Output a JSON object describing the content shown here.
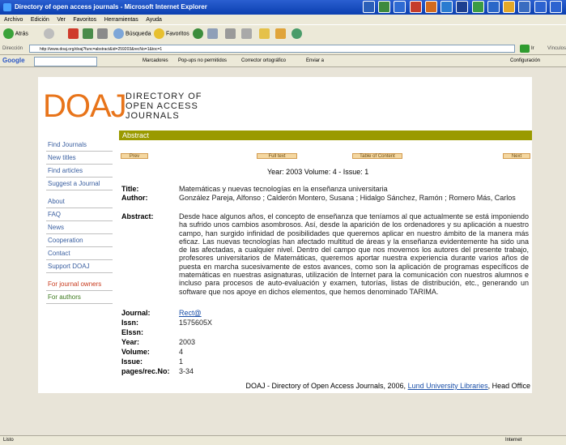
{
  "window": {
    "title": "Directory of open access journals - Microsoft Internet Explorer"
  },
  "menubar": [
    "Archivo",
    "Edición",
    "Ver",
    "Favoritos",
    "Herramientas",
    "Ayuda"
  ],
  "toolbar": {
    "back_label": "Atrás",
    "search_label": "Búsqueda",
    "favorites_label": "Favoritos"
  },
  "addressbar": {
    "label": "Dirección",
    "url": "http://www.doaj.org/doaj?func=abstract&id=259203&recNo=1&toc=1",
    "go_label": "Ir",
    "links_label": "Vínculos"
  },
  "googlebar": {
    "logo": "Google",
    "bookmarks_label": "Marcadores",
    "popups_label": "Pop-ups no permitidos",
    "spellcheck_label": "Corrector ortográfico",
    "send_label": "Enviar a",
    "settings_label": "Configuración"
  },
  "logo": {
    "acronym": "DOAJ",
    "line1": "DIRECTORY OF",
    "line2": "OPEN ACCESS",
    "line3": "JOURNALS"
  },
  "sidebar": {
    "items": [
      {
        "label": "Find Journals"
      },
      {
        "label": "New titles"
      },
      {
        "label": "Find articles"
      },
      {
        "label": "Suggest a Journal"
      },
      {
        "label": "About"
      },
      {
        "label": "FAQ"
      },
      {
        "label": "News"
      },
      {
        "label": "Cooperation"
      },
      {
        "label": "Contact"
      },
      {
        "label": "Support DOAJ"
      },
      {
        "label": "For journal owners"
      },
      {
        "label": "For authors"
      }
    ]
  },
  "abstract_header": "Abstract",
  "nav": {
    "prev": "Prev",
    "fulltext": "Full text",
    "toc": "Table of Content",
    "next": "Next"
  },
  "issue_line": "Year: 2003 Volume: 4 - Issue: 1",
  "fields": {
    "title_label": "Title:",
    "title_value": "Matemáticas y nuevas tecnologías en la enseñanza universitaria",
    "author_label": "Author:",
    "author_value": "González Pareja, Alfonso ; Calderón Montero, Susana ; Hidalgo Sánchez, Ramón ; Romero Más, Carlos",
    "abstract_label": "Abstract:",
    "abstract_value": "Desde hace algunos años, el concepto de enseñanza que teníamos al que actualmente se está imponiendo ha sufrido unos cambios asombrosos. Así, desde la aparición de los ordenadores y su aplicación a nuestro campo, han surgido infinidad de posibilidades que queremos aplicar en nuestro ámbito de la manera más eficaz. Las nuevas tecnologías han afectado multitud de áreas y la enseñanza evidentemente ha sido una de las afectadas, a cualquier nivel. Dentro del campo que nos movemos los autores del presente trabajo, profesores universitarios de Matemáticas, queremos aportar nuestra experiencia durante varios años de puesta en marcha sucesivamente de estos avances, como son la aplicación de programas específicos de matemáticas en nuestras asignaturas, utilización de Internet para la comunicación con nuestros alumnos e incluso para procesos de auto-evaluación y examen, tutorías, listas de distribución, etc., generando un software que nos apoye en dichos elementos, que hemos denominado TARIMA.",
    "journal_label": "Journal:",
    "journal_value": "Rect@",
    "issn_label": "Issn:",
    "issn_value": "1575605X",
    "eissn_label": "EIssn:",
    "eissn_value": "",
    "year_label": "Year:",
    "year_value": "2003",
    "volume_label": "Volume:",
    "volume_value": "4",
    "issue_label": "Issue:",
    "issue_value": "1",
    "pages_label": "pages/rec.No:",
    "pages_value": "3-34"
  },
  "footer": {
    "prefix": "DOAJ - Directory of Open Access Journals, 2006,",
    "link": "Lund University Libraries",
    "suffix": ", Head Office"
  },
  "statusbar": {
    "left": "Listo",
    "right": "Internet"
  }
}
